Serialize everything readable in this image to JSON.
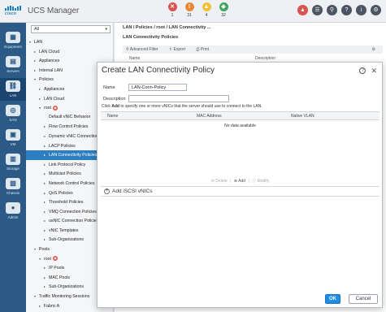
{
  "app": {
    "logo_text": "cisco",
    "title": "UCS Manager"
  },
  "fault_summary": [
    {
      "count": "1",
      "color": "#d9534f",
      "icon": "x-icon"
    },
    {
      "count": "31",
      "color": "#e8893a",
      "icon": "triangle-warning-icon"
    },
    {
      "count": "4",
      "color": "#f0c23a",
      "icon": "warning-icon"
    },
    {
      "count": "32",
      "color": "#3ba55c",
      "icon": "info-icon"
    }
  ],
  "toolbar_icons": [
    "alert-icon",
    "tree-icon",
    "search-icon",
    "help-icon",
    "info-icon",
    "settings-icon"
  ],
  "rail": [
    {
      "label": "Equipment",
      "icon": "equipment-icon"
    },
    {
      "label": "Servers",
      "icon": "servers-icon"
    },
    {
      "label": "LAN",
      "icon": "lan-icon",
      "active": true
    },
    {
      "label": "SAN",
      "icon": "san-icon"
    },
    {
      "label": "VM",
      "icon": "vm-icon"
    },
    {
      "label": "Storage",
      "icon": "storage-icon"
    },
    {
      "label": "Chassis",
      "icon": "chassis-icon"
    },
    {
      "label": "Admin",
      "icon": "admin-icon"
    }
  ],
  "nav": {
    "filter_value": "All",
    "tree": [
      {
        "label": "LAN",
        "indent": 0,
        "toggle": "▾"
      },
      {
        "label": "LAN Cloud",
        "indent": 1,
        "toggle": "▸"
      },
      {
        "label": "Appliances",
        "indent": 1,
        "toggle": "▸"
      },
      {
        "label": "Internal LAN",
        "indent": 1,
        "toggle": "▸"
      },
      {
        "label": "Policies",
        "indent": 1,
        "toggle": "▾"
      },
      {
        "label": "Appliances",
        "indent": 2,
        "toggle": "▸"
      },
      {
        "label": "LAN Cloud",
        "indent": 2,
        "toggle": "▸"
      },
      {
        "label": "root",
        "indent": 2,
        "toggle": "▾",
        "badge": true
      },
      {
        "label": "Default vNIC Behavior",
        "indent": 3,
        "toggle": ""
      },
      {
        "label": "Flow Control Policies",
        "indent": 3,
        "toggle": "▸"
      },
      {
        "label": "Dynamic vNIC Connection P",
        "indent": 3,
        "toggle": "▸"
      },
      {
        "label": "LACP Policies",
        "indent": 3,
        "toggle": "▸"
      },
      {
        "label": "LAN Connectivity Policies",
        "indent": 3,
        "toggle": "▸",
        "selected": true
      },
      {
        "label": "Link Protocol Policy",
        "indent": 3,
        "toggle": "▸"
      },
      {
        "label": "Multicast Policies",
        "indent": 3,
        "toggle": "▸"
      },
      {
        "label": "Network Control Policies",
        "indent": 3,
        "toggle": "▸"
      },
      {
        "label": "QoS Policies",
        "indent": 3,
        "toggle": "▸"
      },
      {
        "label": "Threshold Policies",
        "indent": 3,
        "toggle": "▸"
      },
      {
        "label": "VMQ Connection Policies",
        "indent": 3,
        "toggle": "▸"
      },
      {
        "label": "usNIC Connection Policies",
        "indent": 3,
        "toggle": "▸"
      },
      {
        "label": "vNIC Templates",
        "indent": 3,
        "toggle": "▸"
      },
      {
        "label": "Sub-Organizations",
        "indent": 3,
        "toggle": "▸"
      },
      {
        "label": "Pools",
        "indent": 1,
        "toggle": "▾"
      },
      {
        "label": "root",
        "indent": 2,
        "toggle": "▾",
        "badge": true
      },
      {
        "label": "IP Pools",
        "indent": 3,
        "toggle": "▸"
      },
      {
        "label": "MAC Pools",
        "indent": 3,
        "toggle": "▸"
      },
      {
        "label": "Sub-Organizations",
        "indent": 3,
        "toggle": "▸"
      },
      {
        "label": "Traffic Monitoring Sessions",
        "indent": 1,
        "toggle": "▾"
      },
      {
        "label": "Fabric A",
        "indent": 2,
        "toggle": "▸"
      }
    ]
  },
  "content": {
    "breadcrumb": "LAN / Policies / root / LAN Connectivity ...",
    "title": "LAN Connectivity Policies",
    "toolbar": {
      "filter": "Advanced Filter",
      "export": "Export",
      "print": "Print"
    },
    "columns": [
      "Name",
      "Description"
    ]
  },
  "modal": {
    "title": "Create LAN Connectivity Policy",
    "name_label": "Name",
    "name_value": "LAN-Conn-Policy",
    "description_label": "Description",
    "description_value": "",
    "hint_prefix": "Click ",
    "hint_bold": "Add",
    "hint_suffix": " to specify one or more vNICs that the server should use to connect to the LAN.",
    "columns": [
      "Name",
      "MAC Address",
      "Native VLAN"
    ],
    "empty_text": "No data available",
    "actions": {
      "delete": "Delete",
      "add": "Add",
      "modify": "Modify"
    },
    "iscsi_label": "Add iSCSI vNICs",
    "ok_label": "OK",
    "cancel_label": "Cancel"
  }
}
